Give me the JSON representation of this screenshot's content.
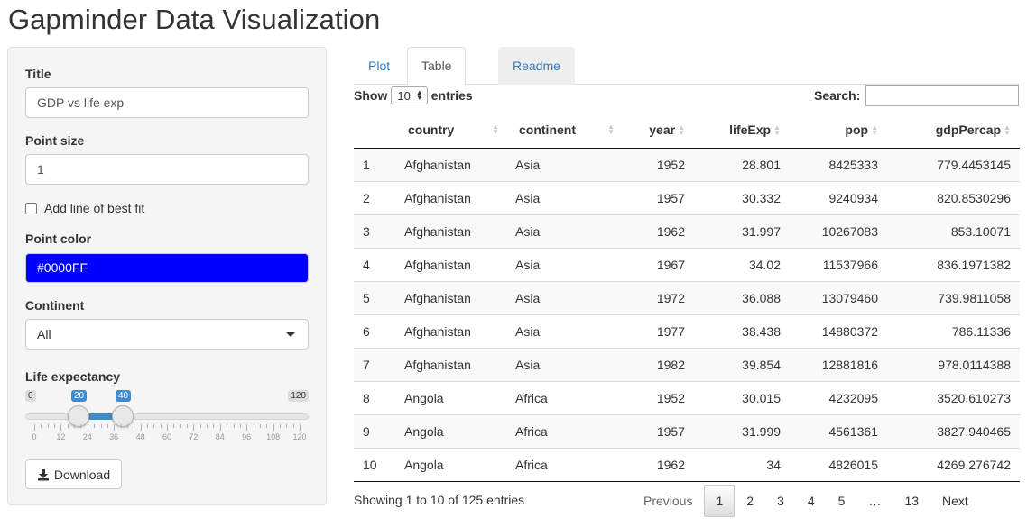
{
  "app_title": "Gapminder Data Visualization",
  "sidebar": {
    "title_label": "Title",
    "title_value": "GDP vs life exp",
    "point_size_label": "Point size",
    "point_size_value": "1",
    "best_fit_label": "Add line of best fit",
    "best_fit_checked": false,
    "point_color_label": "Point color",
    "point_color_value": "#0000FF",
    "continent_label": "Continent",
    "continent_value": "All",
    "life_exp_label": "Life expectancy",
    "slider": {
      "min": 0,
      "max": 120,
      "from": 20,
      "to": 40,
      "min_label": "0",
      "max_label": "120",
      "from_label": "20",
      "to_label": "40",
      "ticks": [
        "0",
        "12",
        "24",
        "36",
        "48",
        "60",
        "72",
        "84",
        "96",
        "108",
        "120"
      ]
    },
    "download_label": "Download"
  },
  "tabs": [
    {
      "label": "Plot",
      "active": false
    },
    {
      "label": "Table",
      "active": true
    },
    {
      "label": "Readme",
      "active": false
    }
  ],
  "table": {
    "show_label": "Show",
    "length_value": "10",
    "entries_label": "entries",
    "search_label": "Search:",
    "search_value": "",
    "columns": [
      "",
      "country",
      "continent",
      "year",
      "lifeExp",
      "pop",
      "gdpPercap"
    ],
    "rows": [
      [
        "1",
        "Afghanistan",
        "Asia",
        "1952",
        "28.801",
        "8425333",
        "779.4453145"
      ],
      [
        "2",
        "Afghanistan",
        "Asia",
        "1957",
        "30.332",
        "9240934",
        "820.8530296"
      ],
      [
        "3",
        "Afghanistan",
        "Asia",
        "1962",
        "31.997",
        "10267083",
        "853.10071"
      ],
      [
        "4",
        "Afghanistan",
        "Asia",
        "1967",
        "34.02",
        "11537966",
        "836.1971382"
      ],
      [
        "5",
        "Afghanistan",
        "Asia",
        "1972",
        "36.088",
        "13079460",
        "739.9811058"
      ],
      [
        "6",
        "Afghanistan",
        "Asia",
        "1977",
        "38.438",
        "14880372",
        "786.11336"
      ],
      [
        "7",
        "Afghanistan",
        "Asia",
        "1982",
        "39.854",
        "12881816",
        "978.0114388"
      ],
      [
        "8",
        "Angola",
        "Africa",
        "1952",
        "30.015",
        "4232095",
        "3520.610273"
      ],
      [
        "9",
        "Angola",
        "Africa",
        "1957",
        "31.999",
        "4561361",
        "3827.940465"
      ],
      [
        "10",
        "Angola",
        "Africa",
        "1962",
        "34",
        "4826015",
        "4269.276742"
      ]
    ],
    "info": "Showing 1 to 10 of 125 entries",
    "pagination": {
      "previous": "Previous",
      "pages": [
        "1",
        "2",
        "3",
        "4",
        "5",
        "…",
        "13"
      ],
      "current": "1",
      "next": "Next"
    }
  },
  "colors": {
    "point_color": "#0000FF",
    "accent": "#428bca",
    "link": "#337ab7"
  }
}
